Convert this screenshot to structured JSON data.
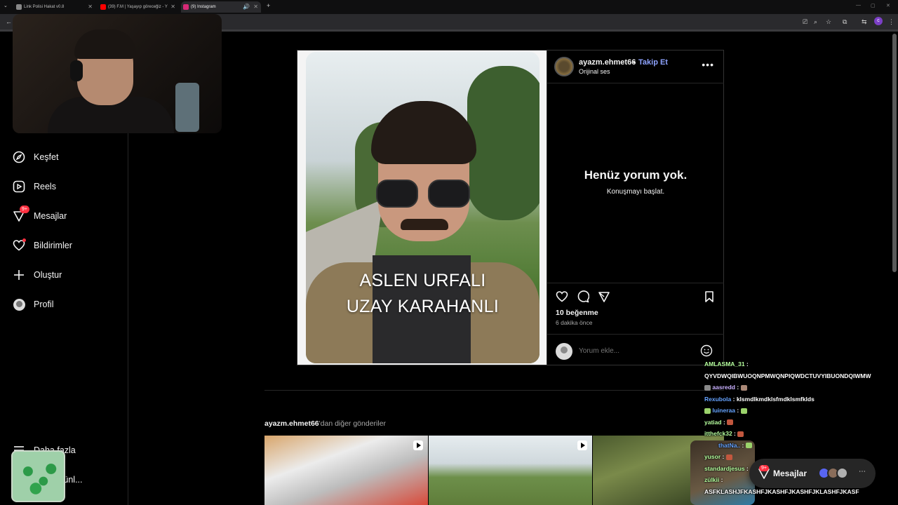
{
  "browser": {
    "tabs": [
      {
        "title": "Link Polisi Hakat v0.8",
        "fav_color": "#888888"
      },
      {
        "title": "(39) F.M | Yaşayıp göreceğiz - Y",
        "fav_color": "#ff0000"
      },
      {
        "title": "(9) Instagram",
        "fav_color": "#d62976"
      }
    ],
    "new_tab": "+",
    "profile_initial": "c"
  },
  "sidebar": {
    "items": [
      {
        "label": "Keşfet",
        "icon": "compass-icon"
      },
      {
        "label": "Reels",
        "icon": "reels-icon"
      },
      {
        "label": "Mesajlar",
        "icon": "messenger-icon",
        "badge": "9+"
      },
      {
        "label": "Bildirimler",
        "icon": "heart-icon"
      },
      {
        "label": "Oluştur",
        "icon": "plus-icon"
      },
      {
        "label": "Profil",
        "icon": "avatar-icon"
      }
    ],
    "more_label": "Daha fazla",
    "other_products": "diğer ürünl..."
  },
  "post": {
    "caption_line1": "ASLEN URFALI",
    "caption_line2": "UZAY KARAHANLI",
    "username": "ayazm.ehmet66",
    "separator": "•",
    "follow_label": "Takip Et",
    "audio": "Orijinal ses",
    "more": "•••",
    "no_comments": "Henüz yorum yok.",
    "start_conversation": "Konuşmayı başlat.",
    "likes": "10 beğenme",
    "time_ago": "6 dakika önce",
    "comment_placeholder": "Yorum ekle..."
  },
  "more_posts": {
    "username": "ayazm.ehmet66",
    "suffix": "'dan diğer gönderiler"
  },
  "messages_pill": {
    "label": "Mesajlar",
    "badge": "9+"
  },
  "chat": [
    {
      "user": "AMLASMA_31",
      "message": "QYVDWQIBWUOQNPMWQNPIQWDCTUVYIBUONDQIWMW"
    },
    {
      "user": "aasredd",
      "message": ""
    },
    {
      "user": "Rexubola",
      "message": "klsmdlkmdklsfmdklsmfklds"
    },
    {
      "user": "luineraa",
      "message": ""
    },
    {
      "user": "yatiad",
      "message": ""
    },
    {
      "user": "itthefck32",
      "message": ""
    },
    {
      "user": "thatNa..",
      "message": ""
    },
    {
      "user": "yusor",
      "message": ""
    },
    {
      "user": "standardjesus",
      "message": ""
    },
    {
      "user": "zülkii",
      "message": ""
    },
    {
      "user": "",
      "message": "ASFKLASHJFKASHFJKASHFJKASHFJKLASHFJKASF"
    }
  ],
  "colors": {
    "accent_link": "#8ea3ff",
    "badge": "#ff3040",
    "background": "#000000"
  }
}
